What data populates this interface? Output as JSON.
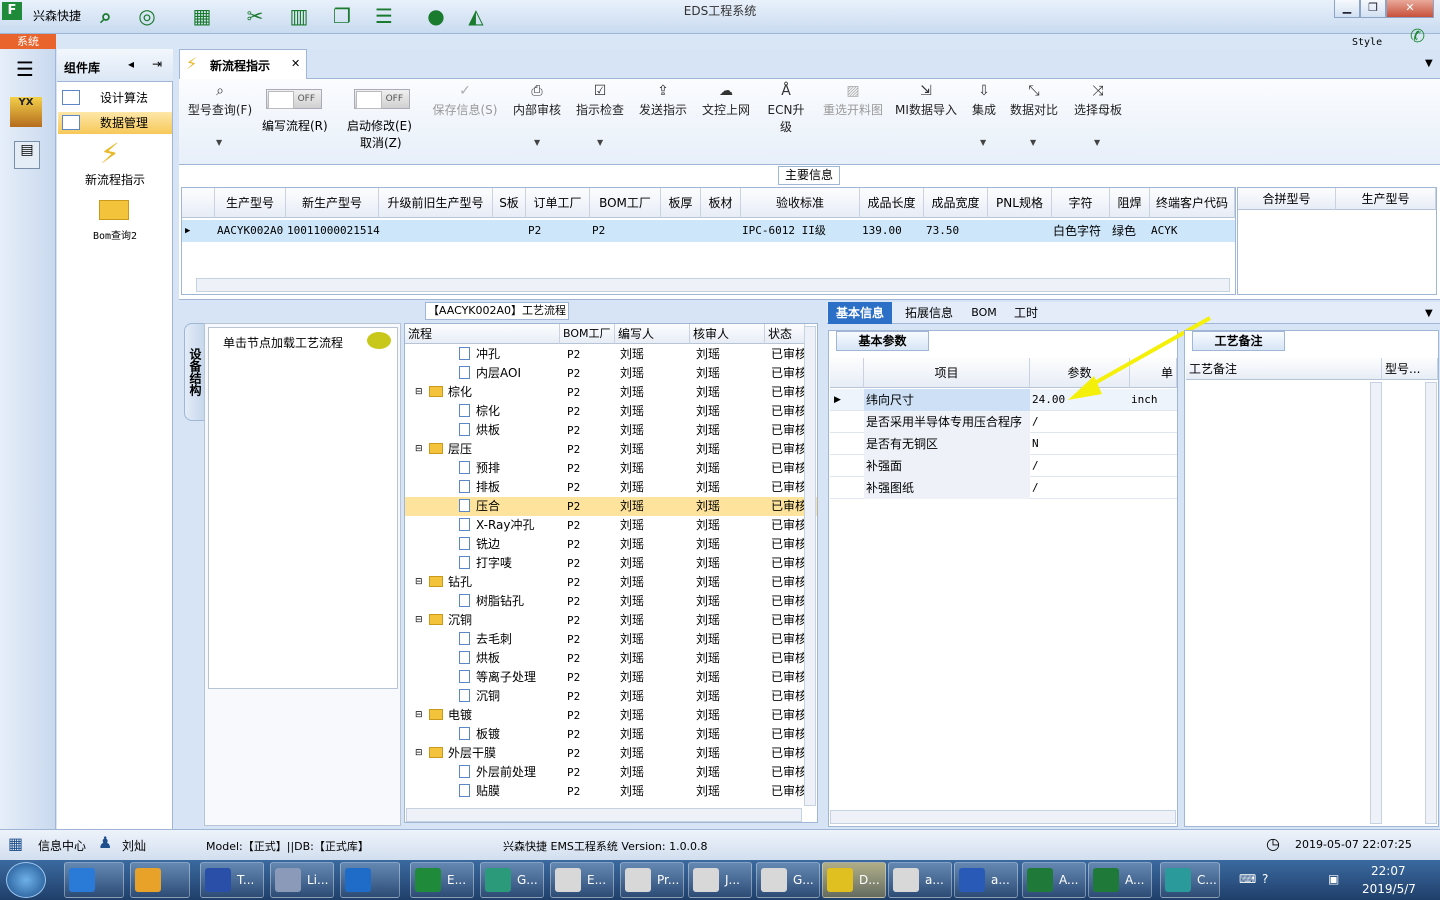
{
  "window": {
    "title": "EDS工程系统",
    "app_name": "兴森快捷",
    "style_label": "Style"
  },
  "system_tab": "系统",
  "component_panel": {
    "title": "组件库",
    "items": [
      {
        "label": "设计算法"
      },
      {
        "label": "数据管理"
      }
    ],
    "tools": [
      {
        "label": "新流程指示"
      },
      {
        "label": "Bom查询2"
      }
    ]
  },
  "doc_tab": {
    "label": "新流程指示"
  },
  "ribbon": {
    "query": "型号查询(F)",
    "edit_flow": {
      "toggle": "OFF",
      "label": "编写流程(R)"
    },
    "start_edit": {
      "toggle": "OFF",
      "label1": "启动修改(E)",
      "label2": "取消(Z)"
    },
    "buttons": [
      "保存信息(S)",
      "内部审核",
      "指示检查",
      "发送指示",
      "文控上网",
      "ECN升级",
      "重选开料图",
      "MI数据导入",
      "集成",
      "数据对比",
      "选择母板"
    ]
  },
  "main_info": {
    "label": "主要信息",
    "columns": [
      "生产型号",
      "新生产型号",
      "升级前旧生产型号",
      "S板",
      "订单工厂",
      "BOM工厂",
      "板厚",
      "板材",
      "验收标准",
      "成品长度",
      "成品宽度",
      "PNL规格",
      "字符",
      "阻焊",
      "终端客户代码"
    ],
    "row": [
      "AACYK002A0",
      "10011000021514",
      "",
      "",
      "P2",
      "P2",
      "",
      "",
      "IPC-6012 II级",
      "139.00",
      "73.50",
      "",
      "白色字符",
      "绿色",
      "ACYK"
    ],
    "side_columns": [
      "合拼型号",
      "生产型号"
    ]
  },
  "process": {
    "title": "【AACYK002A0】工艺流程",
    "vtab": "设备结构",
    "hint": "单击节点加载工艺流程",
    "columns": [
      "流程",
      "BOM工厂",
      "编写人",
      "核审人",
      "状态"
    ],
    "rows": [
      {
        "name": "冲孔",
        "type": "doc",
        "bom": "P2",
        "author": "刘瑶",
        "reviewer": "刘瑶",
        "status": "已审核"
      },
      {
        "name": "内层AOI",
        "type": "doc",
        "bom": "P2",
        "author": "刘瑶",
        "reviewer": "刘瑶",
        "status": "已审核"
      },
      {
        "name": "棕化",
        "type": "folder",
        "bom": "P2",
        "author": "刘瑶",
        "reviewer": "刘瑶",
        "status": "已审核"
      },
      {
        "name": "棕化",
        "type": "doc",
        "bom": "P2",
        "author": "刘瑶",
        "reviewer": "刘瑶",
        "status": "已审核"
      },
      {
        "name": "烘板",
        "type": "doc",
        "bom": "P2",
        "author": "刘瑶",
        "reviewer": "刘瑶",
        "status": "已审核"
      },
      {
        "name": "层压",
        "type": "folder",
        "bom": "P2",
        "author": "刘瑶",
        "reviewer": "刘瑶",
        "status": "已审核"
      },
      {
        "name": "预排",
        "type": "doc",
        "bom": "P2",
        "author": "刘瑶",
        "reviewer": "刘瑶",
        "status": "已审核"
      },
      {
        "name": "排板",
        "type": "doc",
        "bom": "P2",
        "author": "刘瑶",
        "reviewer": "刘瑶",
        "status": "已审核"
      },
      {
        "name": "压合",
        "type": "doc",
        "bom": "P2",
        "author": "刘瑶",
        "reviewer": "刘瑶",
        "status": "已审核",
        "selected": true
      },
      {
        "name": "X-Ray冲孔",
        "type": "doc",
        "bom": "P2",
        "author": "刘瑶",
        "reviewer": "刘瑶",
        "status": "已审核"
      },
      {
        "name": "铣边",
        "type": "doc",
        "bom": "P2",
        "author": "刘瑶",
        "reviewer": "刘瑶",
        "status": "已审核"
      },
      {
        "name": "打字唛",
        "type": "doc",
        "bom": "P2",
        "author": "刘瑶",
        "reviewer": "刘瑶",
        "status": "已审核"
      },
      {
        "name": "钻孔",
        "type": "folder",
        "bom": "P2",
        "author": "刘瑶",
        "reviewer": "刘瑶",
        "status": "已审核"
      },
      {
        "name": "树脂钻孔",
        "type": "doc",
        "bom": "P2",
        "author": "刘瑶",
        "reviewer": "刘瑶",
        "status": "已审核"
      },
      {
        "name": "沉铜",
        "type": "folder",
        "bom": "P2",
        "author": "刘瑶",
        "reviewer": "刘瑶",
        "status": "已审核"
      },
      {
        "name": "去毛刺",
        "type": "doc",
        "bom": "P2",
        "author": "刘瑶",
        "reviewer": "刘瑶",
        "status": "已审核"
      },
      {
        "name": "烘板",
        "type": "doc",
        "bom": "P2",
        "author": "刘瑶",
        "reviewer": "刘瑶",
        "status": "已审核"
      },
      {
        "name": "等离子处理",
        "type": "doc",
        "bom": "P2",
        "author": "刘瑶",
        "reviewer": "刘瑶",
        "status": "已审核"
      },
      {
        "name": "沉铜",
        "type": "doc",
        "bom": "P2",
        "author": "刘瑶",
        "reviewer": "刘瑶",
        "status": "已审核"
      },
      {
        "name": "电镀",
        "type": "folder",
        "bom": "P2",
        "author": "刘瑶",
        "reviewer": "刘瑶",
        "status": "已审核"
      },
      {
        "name": "板镀",
        "type": "doc",
        "bom": "P2",
        "author": "刘瑶",
        "reviewer": "刘瑶",
        "status": "已审核"
      },
      {
        "name": "外层干膜",
        "type": "folder",
        "bom": "P2",
        "author": "刘瑶",
        "reviewer": "刘瑶",
        "status": "已审核"
      },
      {
        "name": "外层前处理",
        "type": "doc",
        "bom": "P2",
        "author": "刘瑶",
        "reviewer": "刘瑶",
        "status": "已审核"
      },
      {
        "name": "贴膜",
        "type": "doc",
        "bom": "P2",
        "author": "刘瑶",
        "reviewer": "刘瑶",
        "status": "已审核"
      }
    ]
  },
  "right_tabs": [
    "基本信息",
    "拓展信息",
    "BOM",
    "工时"
  ],
  "basic_params": {
    "tab": "基本参数",
    "columns": [
      "项目",
      "参数",
      "单"
    ],
    "rows": [
      {
        "item": "纬向尺寸",
        "value": "24.00",
        "unit": "inch"
      },
      {
        "item": "是否采用半导体专用压合程序",
        "value": "/",
        "unit": ""
      },
      {
        "item": "是否有无铜区",
        "value": "N",
        "unit": ""
      },
      {
        "item": "补强面",
        "value": "/",
        "unit": ""
      },
      {
        "item": "补强图纸",
        "value": "/",
        "unit": ""
      }
    ]
  },
  "process_notes": {
    "tab": "工艺备注",
    "col1": "工艺备注",
    "col2": "型号..."
  },
  "status": {
    "info_center": "信息中心",
    "user": "刘灿",
    "model": "Model:【正式】||DB:【正式库】",
    "version": "兴森快捷 EMS工程系统 Version: 1.0.0.8",
    "datetime": "2019-05-07 22:07:25"
  },
  "taskbar": {
    "items": [
      "T...",
      "Li...",
      "",
      "E...",
      "G...",
      "E...",
      "Pr...",
      "J...",
      "G...",
      "D...",
      "a...",
      "a...",
      "A...",
      "A...",
      "C..."
    ],
    "time": "22:07",
    "date": "2019/5/7"
  },
  "colors": {
    "accent": "#e8642c",
    "selection": "#cde6fa",
    "tree_selection": "#fde39b",
    "annotation_arrow": "#f5f00a"
  }
}
